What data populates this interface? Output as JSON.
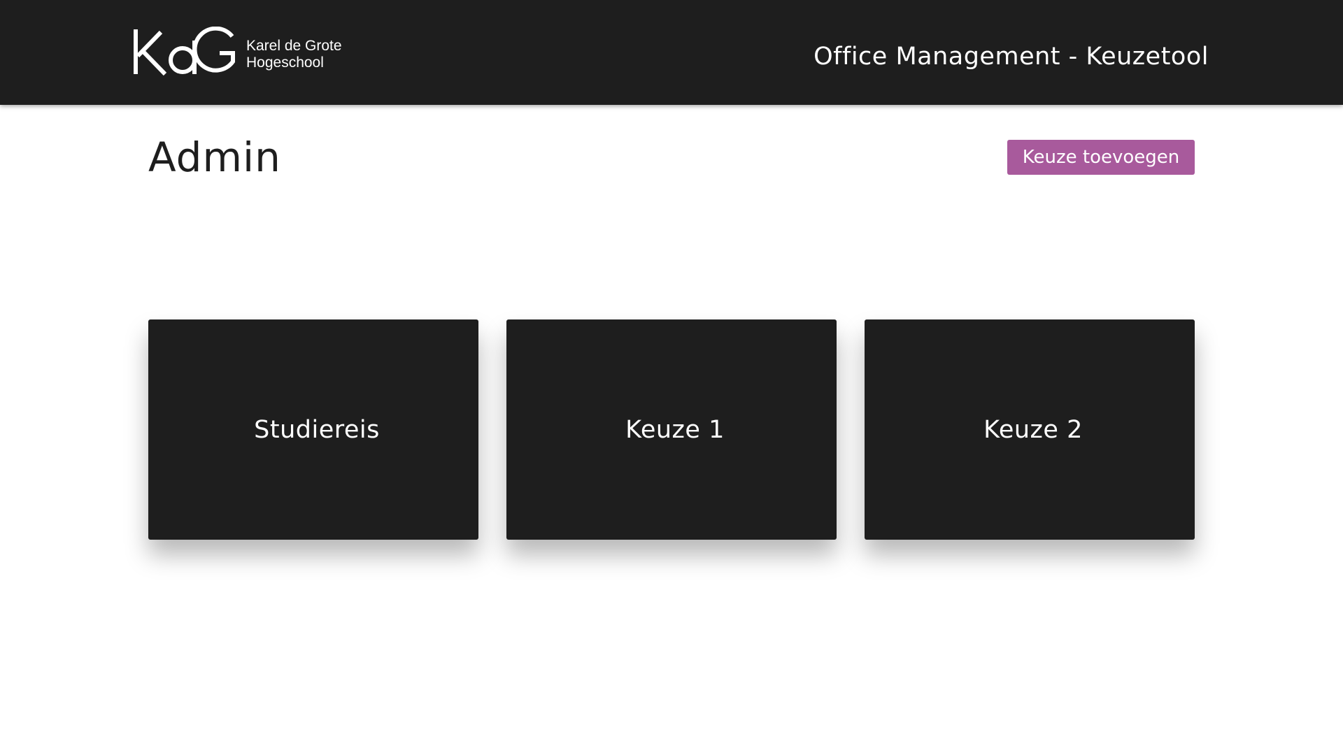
{
  "header": {
    "logo": {
      "mark": "KdG",
      "line1": "Karel de Grote",
      "line2": "Hogeschool"
    },
    "app_title": "Office Management - Keuzetool"
  },
  "main": {
    "page_title": "Admin",
    "add_button_label": "Keuze toevoegen",
    "cards": [
      {
        "label": "Studiereis"
      },
      {
        "label": "Keuze 1"
      },
      {
        "label": "Keuze 2"
      }
    ]
  },
  "colors": {
    "header_background": "#1e1e1e",
    "card_background": "#1e1e1e",
    "accent_button": "#a85a9c",
    "page_background": "#ffffff",
    "text_light": "#ffffff",
    "text_dark": "#1e1e1e"
  }
}
